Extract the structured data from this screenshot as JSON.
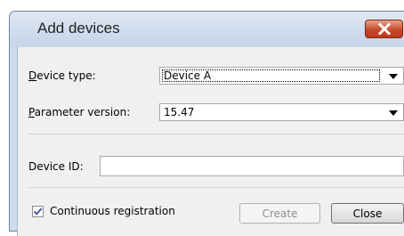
{
  "dialog": {
    "title": "Add devices",
    "close_icon": "close-icon",
    "accent_close": "#c7482a"
  },
  "form": {
    "device_type": {
      "label_hotkey": "D",
      "label_rest": "evice type:",
      "value": "Device A"
    },
    "parameter_version": {
      "label_hotkey": "P",
      "label_rest": "arameter version:",
      "value": "15.47"
    },
    "device_id": {
      "label": "Device ID:",
      "value": ""
    },
    "continuous_registration": {
      "label": "Continuous registration",
      "checked": true
    }
  },
  "buttons": {
    "create": "Create",
    "close": "Close"
  }
}
